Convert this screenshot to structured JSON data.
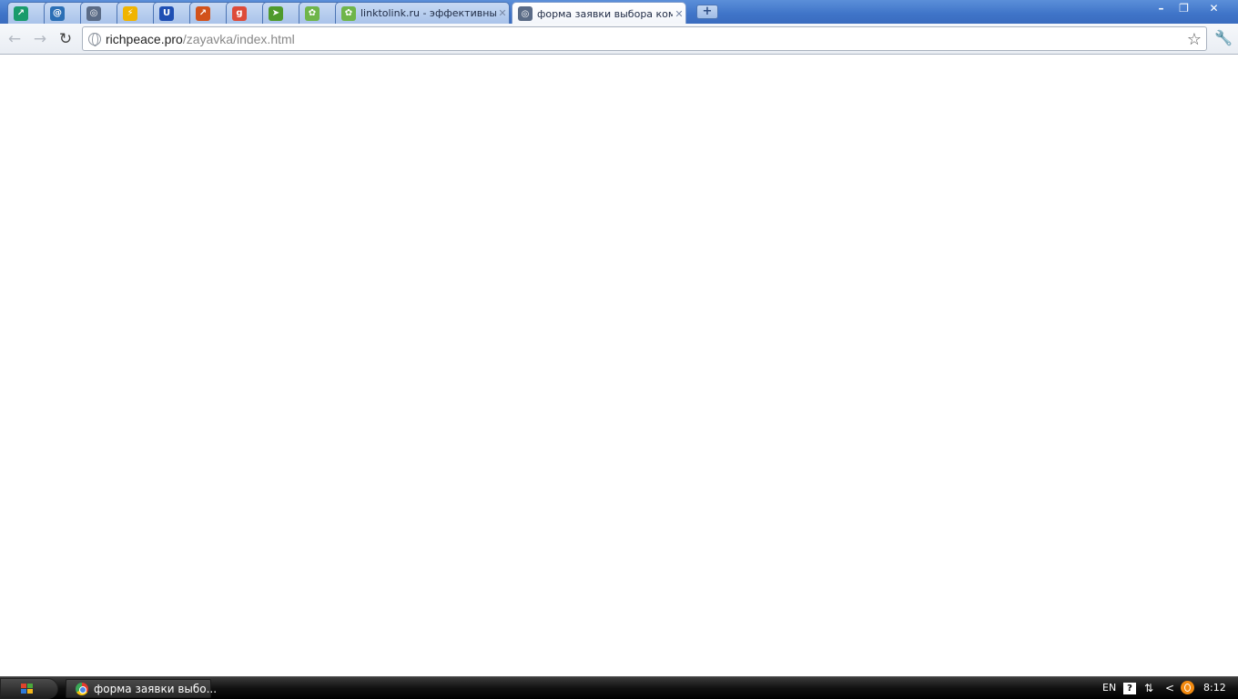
{
  "browser": {
    "tabs": [
      {
        "icon": "green-square-icon",
        "title": "",
        "color": "#1a9b6c",
        "glyph": "↗"
      },
      {
        "icon": "at-sign-icon",
        "title": "",
        "color": "#2b6fb5",
        "glyph": "@"
      },
      {
        "icon": "globe-icon",
        "title": "",
        "color": "#5a6b86",
        "glyph": "◎"
      },
      {
        "icon": "lightning-icon",
        "title": "",
        "color": "#f0b400",
        "glyph": "⚡"
      },
      {
        "icon": "u-letter-icon",
        "title": "",
        "color": "#1f4fb3",
        "glyph": "U"
      },
      {
        "icon": "chart-icon",
        "title": "",
        "color": "#d2521b",
        "glyph": "↗"
      },
      {
        "icon": "google-icon",
        "title": "",
        "color": "#dd4b39",
        "glyph": "g"
      },
      {
        "icon": "green-arrow-icon",
        "title": "",
        "color": "#4f9a2c",
        "glyph": "➤"
      },
      {
        "icon": "linktolink-icon",
        "title": "",
        "color": "#6fb54a",
        "glyph": "✿"
      },
      {
        "icon": "linktolink-icon",
        "title": "linktolink.ru - эффективный о",
        "color": "#6fb54a",
        "glyph": "✿"
      },
      {
        "icon": "globe-icon",
        "title": "форма заявки выбора компл",
        "color": "#5a6b86",
        "glyph": "◎",
        "active": true
      }
    ],
    "new_tab_label": "+",
    "window_controls": {
      "minimize": "–",
      "restore": "❐",
      "close": "✕"
    },
    "toolbar": {
      "back": "←",
      "forward": "→",
      "reload": "↻",
      "url_host": "richpeace.pro",
      "url_path": "/zayavka/index.html",
      "star": "☆",
      "wrench": "🔧"
    }
  },
  "taskbar": {
    "task_label": "форма заявки выбо...",
    "tray": {
      "lang": "EN",
      "help": "?",
      "network": "⇅",
      "expand": "<",
      "clock": "8:12"
    }
  }
}
